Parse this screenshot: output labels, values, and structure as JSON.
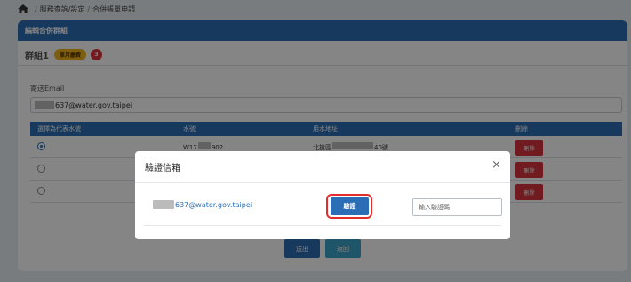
{
  "breadcrumb": {
    "home_icon": "home-icon",
    "separator": "/",
    "items": [
      "服務查詢/設定",
      "合併帳單申請"
    ]
  },
  "panel": {
    "title": "編輯合併群組",
    "group": {
      "title": "群組1",
      "fee_badge": "單月繳費",
      "count_badge": "3"
    },
    "email": {
      "label": "寄送Email",
      "value_suffix": "637@water.gov.taipei"
    },
    "table": {
      "headers": [
        "選擇為代表水號",
        "水號",
        "用水地址",
        "刪除"
      ],
      "rows": [
        {
          "selected": true,
          "water_no_prefix": "W17",
          "water_no_suffix": "902",
          "address_prefix": "北投區",
          "address_suffix": "40號",
          "delete_label": "刪除"
        },
        {
          "selected": false,
          "water_no_prefix": "",
          "water_no_suffix": "",
          "address_prefix": "",
          "address_suffix": "",
          "delete_label": "刪除"
        },
        {
          "selected": false,
          "water_no_prefix": "",
          "water_no_suffix": "",
          "address_prefix": "",
          "address_suffix": "",
          "delete_label": "刪除"
        }
      ]
    },
    "buttons": {
      "submit": "送出",
      "back": "返回"
    }
  },
  "modal": {
    "title": "驗證信箱",
    "close_icon": "close-icon",
    "email_suffix": "637@water.gov.taipei",
    "verify_label": "驗證",
    "code_placeholder": "輸入驗證碼"
  },
  "colors": {
    "primary": "#2c6eb5",
    "danger": "#d9343f",
    "highlight_ring": "#e32c2c",
    "badge_yellow": "#f0b21c"
  }
}
